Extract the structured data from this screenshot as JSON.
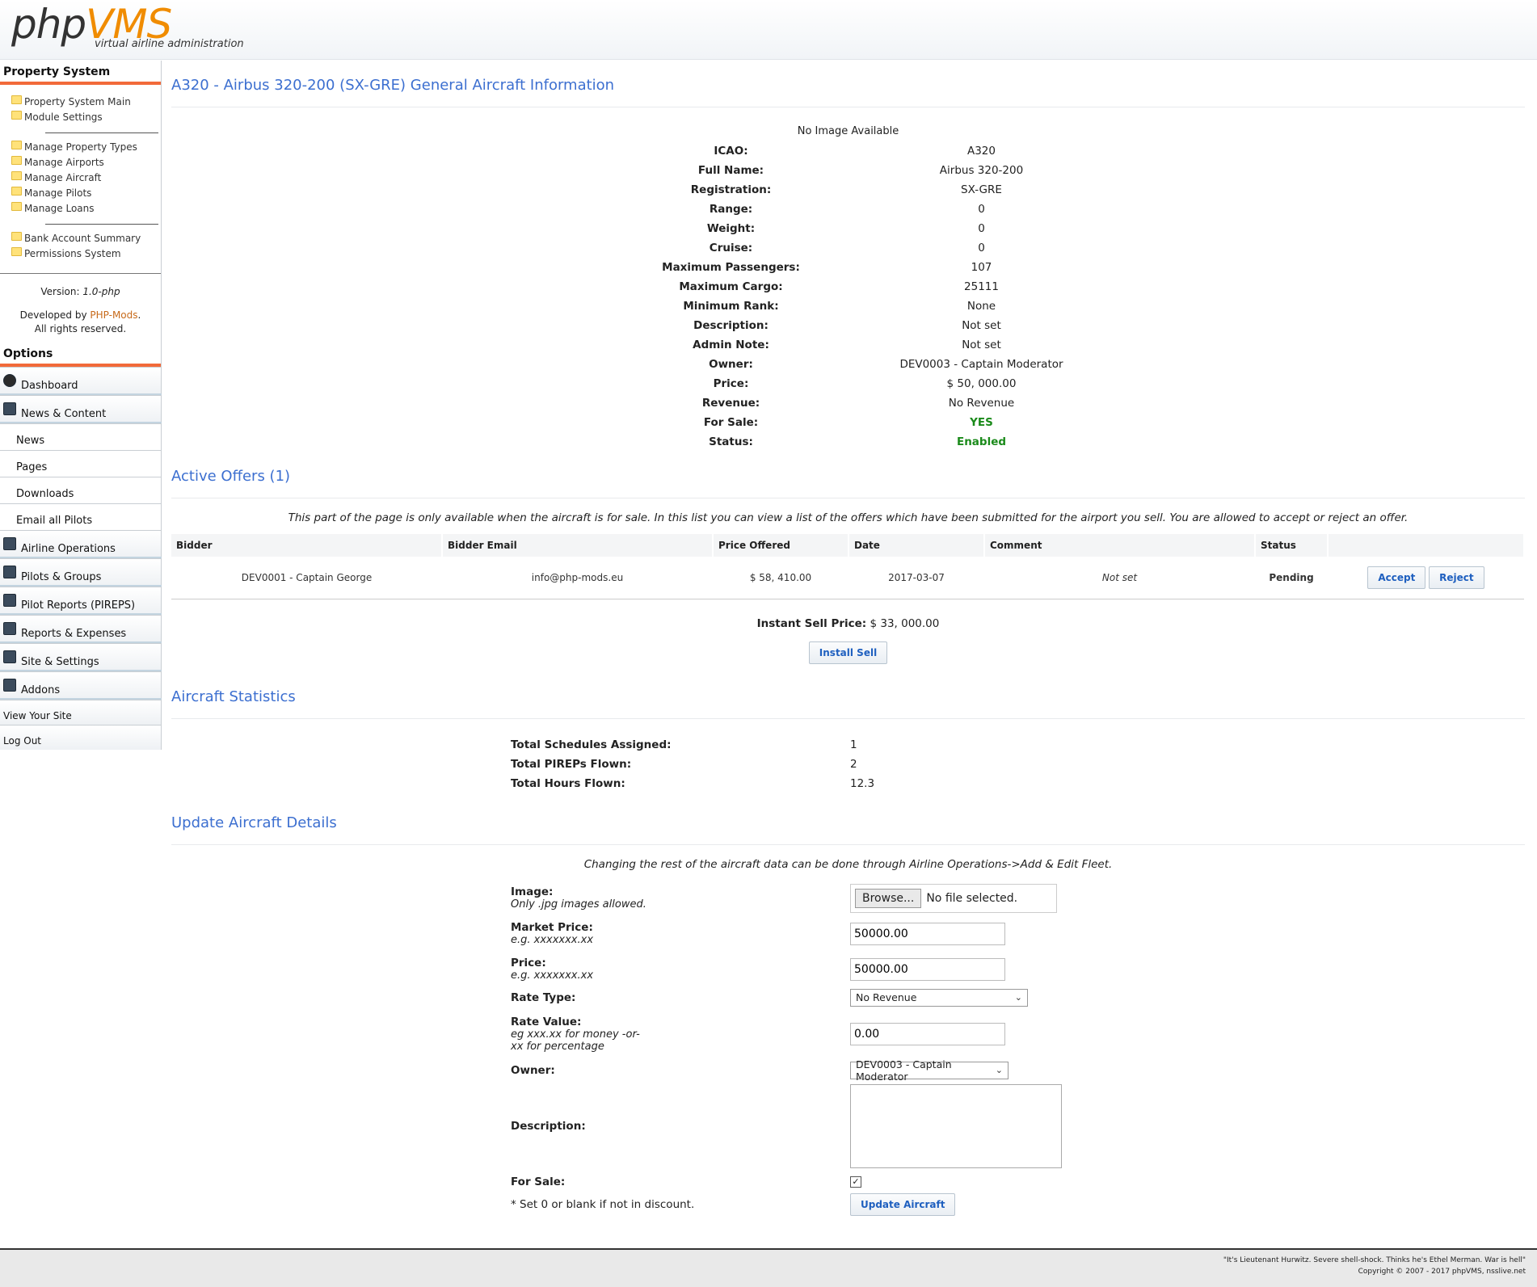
{
  "header": {
    "logo_php": "php",
    "logo_vms": "VMS",
    "tagline": "virtual airline administration"
  },
  "sidebar": {
    "property_title": "Property System",
    "property_items_a": [
      {
        "label": "Property System Main"
      },
      {
        "label": "Module Settings"
      }
    ],
    "property_items_b": [
      {
        "label": "Manage Property Types"
      },
      {
        "label": "Manage Airports"
      },
      {
        "label": "Manage Aircraft"
      },
      {
        "label": "Manage Pilots"
      },
      {
        "label": "Manage Loans"
      }
    ],
    "property_items_c": [
      {
        "label": "Bank Account Summary"
      },
      {
        "label": "Permissions System"
      }
    ],
    "version_label": "Version:",
    "version_value": "1.0-php",
    "developed_by": "Developed by",
    "developer": "PHP-Mods",
    "rights": "All rights reserved.",
    "options_title": "Options",
    "options": {
      "dashboard": "Dashboard",
      "news_content": "News & Content",
      "news": "News",
      "pages": "Pages",
      "downloads": "Downloads",
      "email_pilots": "Email all Pilots",
      "airline_ops": "Airline Operations",
      "pilots_groups": "Pilots & Groups",
      "pilot_reports": "Pilot Reports (PIREPS)",
      "reports_expenses": "Reports & Expenses",
      "site_settings": "Site & Settings",
      "addons": "Addons",
      "view_site": "View Your Site",
      "log_out": "Log Out"
    }
  },
  "general": {
    "title": "A320 - Airbus 320-200 (SX-GRE) General Aircraft Information",
    "no_image": "No Image Available",
    "rows": [
      {
        "k": "ICAO:",
        "v": "A320"
      },
      {
        "k": "Full Name:",
        "v": "Airbus 320-200"
      },
      {
        "k": "Registration:",
        "v": "SX-GRE"
      },
      {
        "k": "Range:",
        "v": "0"
      },
      {
        "k": "Weight:",
        "v": "0"
      },
      {
        "k": "Cruise:",
        "v": "0"
      },
      {
        "k": "Maximum Passengers:",
        "v": "107"
      },
      {
        "k": "Maximum Cargo:",
        "v": "25111"
      },
      {
        "k": "Minimum Rank:",
        "v": "None"
      },
      {
        "k": "Description:",
        "v": "Not set"
      },
      {
        "k": "Admin Note:",
        "v": "Not set"
      },
      {
        "k": "Owner:",
        "v": "DEV0003 - Captain Moderator"
      },
      {
        "k": "Price:",
        "v": "$ 50, 000.00"
      },
      {
        "k": "Revenue:",
        "v": "No Revenue"
      }
    ],
    "for_sale_label": "For Sale:",
    "for_sale_value": "YES",
    "status_label": "Status:",
    "status_value": "Enabled"
  },
  "offers": {
    "title": "Active Offers (1)",
    "notice": "This part of the page is only available when the aircraft is for sale. In this list you can view a list of the offers which have been submitted for the airport you sell. You are allowed to accept or reject an offer.",
    "columns": [
      "Bidder",
      "Bidder Email",
      "Price Offered",
      "Date",
      "Comment",
      "Status",
      ""
    ],
    "row": {
      "bidder": "DEV0001 - Captain George",
      "email": "info@php-mods.eu",
      "price": "$ 58, 410.00",
      "date": "2017-03-07",
      "comment": "Not set",
      "status": "Pending",
      "accept": "Accept",
      "reject": "Reject"
    },
    "instant_label": "Instant Sell Price:",
    "instant_value": "$ 33, 000.00",
    "instant_button": "Install Sell"
  },
  "stats": {
    "title": "Aircraft Statistics",
    "rows": [
      {
        "k": "Total Schedules Assigned:",
        "v": "1"
      },
      {
        "k": "Total PIREPs Flown:",
        "v": "2"
      },
      {
        "k": "Total Hours Flown:",
        "v": "12.3"
      }
    ]
  },
  "update": {
    "title": "Update Aircraft Details",
    "notice": "Changing the rest of the aircraft data can be done through Airline Operations->Add & Edit Fleet.",
    "image_label": "Image:",
    "image_hint": "Only .jpg images allowed.",
    "browse_label": "Browse...",
    "file_status": "No file selected.",
    "market_price_label": "Market Price:",
    "market_price_hint": "e.g. xxxxxxx.xx",
    "market_price_value": "50000.00",
    "price_label": "Price:",
    "price_hint": "e.g. xxxxxxx.xx",
    "price_value": "50000.00",
    "rate_type_label": "Rate Type:",
    "rate_type_value": "No Revenue",
    "rate_value_label": "Rate Value:",
    "rate_value_hint1": "eg xxx.xx for money -or-",
    "rate_value_hint2": "xx for percentage",
    "rate_value_value": "0.00",
    "owner_label": "Owner:",
    "owner_value": "DEV0003 - Captain Moderator",
    "description_label": "Description:",
    "for_sale_label": "For Sale:",
    "footnote": "* Set 0 or blank if not in discount.",
    "submit": "Update Aircraft"
  },
  "footer": {
    "quote": "\"It's Lieutenant Hurwitz. Severe shell-shock. Thinks he's Ethel Merman. War is hell\"",
    "copyright": "Copyright © 2007 - 2017 phpVMS, nsslive.net"
  }
}
